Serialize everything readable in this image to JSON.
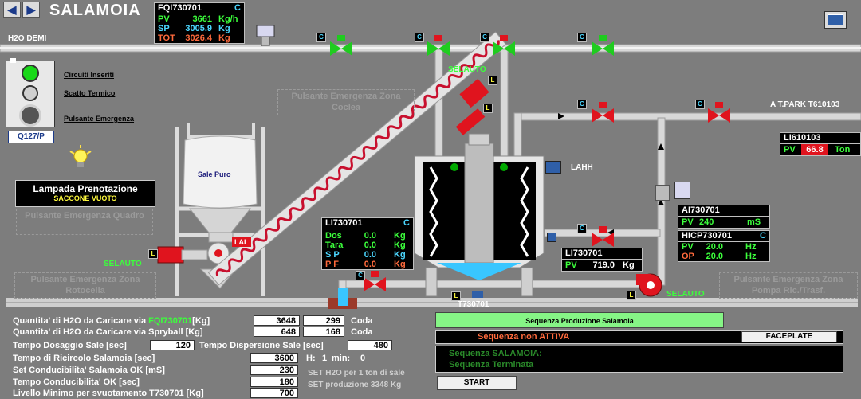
{
  "header": {
    "title": "SALAMOIA",
    "back_icon": "arrow-left-icon",
    "forward_icon": "arrow-right-icon",
    "settings_icon": "display-settings-icon"
  },
  "pipe_label_h2o": "H2O DEMI",
  "pipe_label_tpark": "A T.PARK T610103",
  "fqi": {
    "tag": "FQI730701",
    "c": "C",
    "rows": [
      {
        "k": "PV",
        "v": "3661",
        "u": "Kg/h",
        "color": "#3cff3c"
      },
      {
        "k": "SP",
        "v": "3005.9",
        "u": "Kg",
        "color": "#4cd7ff"
      },
      {
        "k": "TOT",
        "v": "3026.4",
        "u": "Kg",
        "color": "#ff6a3c"
      }
    ]
  },
  "panel": {
    "circuiti": "Circuiti Inseriti",
    "scatto": "Scatto Termico",
    "pulsante": "Pulsante Emergenza",
    "code": "Q127/P"
  },
  "lampada": {
    "title": "Lampada Prenotazione",
    "sub": "SACCONE VUOTO"
  },
  "ghosts": {
    "quadro": "Pulsante Emergenza Quadro",
    "coclea": "Pulsante Emergenza Zona Coclea",
    "rotocella": "Pulsante Emergenza Zona Rotocella",
    "pompa": "Pulsante Emergenza Zona Pompa Ric./Trasf."
  },
  "sale_puro": "Sale Puro",
  "lal": "LAL",
  "lahh": "LAHH",
  "selauto": "SELAUTO",
  "c_badge": "C",
  "l_badge": "L",
  "tank_tag": "T730701",
  "li730701_box": {
    "tag": "LI730701",
    "c": "C",
    "rows": [
      {
        "k": "Dos",
        "v": "0.0",
        "u": "Kg",
        "color": "#3cff3c"
      },
      {
        "k": "Tara",
        "v": "0.0",
        "u": "Kg",
        "color": "#3cff3c"
      },
      {
        "k": "S P",
        "v": "0.0",
        "u": "Kg",
        "color": "#4cd7ff"
      },
      {
        "k": "P F",
        "v": "0.0",
        "u": "Kg",
        "color": "#ff6a3c"
      }
    ]
  },
  "li730701_pv": {
    "tag": "LI730701",
    "k": "PV",
    "v": "719.0",
    "u": "Kg"
  },
  "li610103": {
    "tag": "LI610103",
    "k": "PV",
    "v": "66.8",
    "u": "Ton"
  },
  "ai730701": {
    "tag": "AI730701",
    "k": "PV",
    "v": "240",
    "u": "mS"
  },
  "hicp": {
    "tag": "HICP730701",
    "c": "C",
    "rows": [
      {
        "k": "PV",
        "v": "20.0",
        "u": "Hz"
      },
      {
        "k": "OP",
        "v": "20.0",
        "u": "Hz"
      }
    ]
  },
  "bottom": {
    "r1_label": "Quantita' di H2O  da Caricare via",
    "r1_tag": "FQI730701",
    "r1_unit": "[Kg]",
    "r1_v1": "3648",
    "r1_v2": "299",
    "coda": "Coda",
    "r2_label": "Quantita' di H2O  da Caricare via Spryball [Kg]",
    "r2_v1": "648",
    "r2_v2": "168",
    "r3_label": "Tempo Dosaggio Sale [sec]",
    "r3_v": "120",
    "r3b_label": "Tempo Dispersione Sale [sec]",
    "r3b_v": "480",
    "r4_label": "Tempo di Ricircolo Salamoia [sec]",
    "r4_v": "3600",
    "h_label": "H:",
    "h_v": "1",
    "min_label": "min:",
    "min_v": "0",
    "r5_label": "Set Conducibilita' Salamoia OK [mS]",
    "r5_v": "230",
    "r6_label": "Tempo Conducibilita' OK [sec]",
    "r6_v": "180",
    "r7_label": "Livello Minimo per svuotamento T730701 [Kg]",
    "r7_v": "700",
    "set_h2o": "SET H2O per 1 ton di sale",
    "set_prod": "SET produzione 3348 Kg"
  },
  "seq": {
    "header": "Sequenza Produzione Salamoia",
    "status": "Sequenza non ATTIVA",
    "faceplate": "FACEPLATE",
    "msg1": "Sequenza SALAMOIA:",
    "msg2": "Sequenza Terminata",
    "start": "START"
  },
  "colors": {
    "valve_red": "#e0141e",
    "valve_green": "#1fcc1f",
    "accent_cyan": "#4cd7ff",
    "background": "#7d7d7d"
  }
}
